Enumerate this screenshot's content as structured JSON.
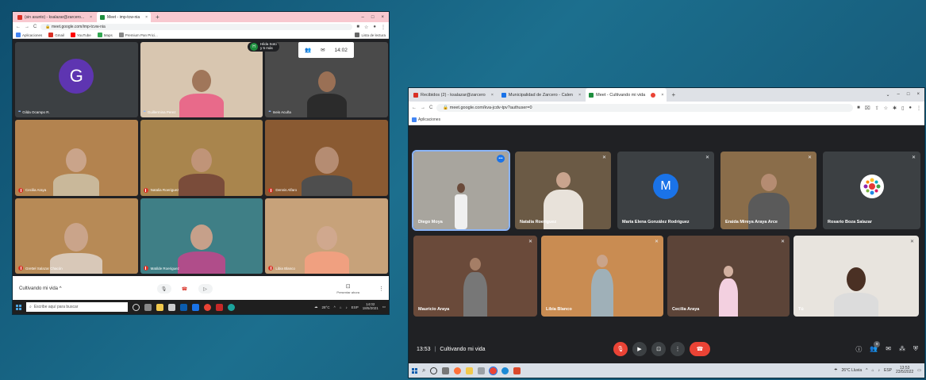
{
  "ss1": {
    "tabs": [
      {
        "label": "(sin asunto) - ksalazar@zarcero...",
        "active": false,
        "favicon_color": "#d93025"
      },
      {
        "label": "Meet - imp-tcw-nia",
        "active": true,
        "favicon_color": "#1e8e3e"
      }
    ],
    "url": "meet.google.com/imp-tcvw-nia",
    "bookmarks": [
      {
        "label": "Aplicaciones",
        "color": "#4285f4"
      },
      {
        "label": "Gmail",
        "color": "#d93025"
      },
      {
        "label": "YouTube",
        "color": "#ff0000"
      },
      {
        "label": "Maps",
        "color": "#34a853"
      },
      {
        "label": "Premium Pan Prici...",
        "color": "#888888"
      }
    ],
    "reading_list": "Lista de lectura",
    "badge": {
      "letter": "H",
      "line1": "Hilda Soto",
      "line2": "y 5 más"
    },
    "clock_top": "14:02",
    "tiles": [
      {
        "name": "Gilda Ocampo R.",
        "status": "speaking",
        "avatar_letter": "G",
        "avatar_color": "#5e35b1"
      },
      {
        "name": "Guillermina Perez",
        "status": "speaking",
        "bg": "#d8c6b0",
        "shirt": "#e86a8a"
      },
      {
        "name": "Ineis Acuña",
        "status": "speaking",
        "bg": "#4a4a4a",
        "shirt": "#2b2b2b"
      },
      {
        "name": "Cecilia Araya",
        "status": "muted",
        "bg": "#b3834f",
        "shirt": "#c9b89a"
      },
      {
        "name": "Natalia Roeriguez",
        "status": "muted",
        "bg": "#a9854d",
        "shirt": "#7a4c3a"
      },
      {
        "name": "Dennis Alfaro",
        "status": "muted",
        "bg": "#8a5a32",
        "shirt": "#4e4e4e"
      },
      {
        "name": "Grettel Salazar Chacón",
        "status": "muted",
        "bg": "#b78a56",
        "shirt": "#d8c8b8"
      },
      {
        "name": "Matilde Roeriguez",
        "status": "muted",
        "bg": "#3f7f86",
        "shirt": "#b04d8a"
      },
      {
        "name": "Libia Blanco",
        "status": "muted",
        "bg": "#c7a27a",
        "shirt": "#f0a080"
      }
    ],
    "meeting_title": "Cultivando mi vida",
    "present_label": "Presentar ahora",
    "taskbar": {
      "search_placeholder": "Escribe aquí para buscar",
      "weather": "28°C",
      "lang": "ESP",
      "time": "14:02",
      "date": "18/5/2021"
    }
  },
  "ss2": {
    "tabs": [
      {
        "label": "Recibidos (2) - ksalazar@zarcero",
        "active": false,
        "favicon_color": "#d93025"
      },
      {
        "label": "Municipalidad de Zarcero - Calen",
        "active": false,
        "favicon_color": "#1a73e8"
      },
      {
        "label": "Meet - Cultivando mi vida",
        "active": true,
        "favicon_color": "#1e8e3e"
      }
    ],
    "url": "meet.google.com/kva-jcdv-tpv?authuser=0",
    "bookmarks": [
      {
        "label": "Aplicaciones",
        "color": "#4285f4"
      }
    ],
    "tiles": [
      {
        "name": "Diego Moya",
        "speaking": true,
        "bg": "#a8a59e",
        "shirt": "#f0f0f0"
      },
      {
        "name": "Natalia Roeriguez",
        "speaking": false,
        "bg": "#6b5a45",
        "shirt": "#e8e2da"
      },
      {
        "name": "María Elena González Rodríguez",
        "speaking": false,
        "avatar_letter": "M",
        "avatar_color": "#1a73e8"
      },
      {
        "name": "Eraida Mireya Araya Arce",
        "speaking": false,
        "bg": "#8a6d4a",
        "shirt": "#5a5a5a"
      },
      {
        "name": "Rosario Boza Salazar",
        "speaking": false,
        "avatar_logo": true
      },
      {
        "name": "Mauricio Araya",
        "speaking": false,
        "bg": "#6a4a3a",
        "shirt": "#777777"
      },
      {
        "name": "Libia Blanco",
        "speaking": false,
        "bg": "#c98c52",
        "shirt": "#9fb0b8"
      },
      {
        "name": "Cecilia Araya",
        "speaking": false,
        "bg": "#5c4438",
        "shirt": "#f3d0e0"
      },
      {
        "name": "Tú",
        "speaking": false,
        "bg": "#e8e4de",
        "shirt": "#dcdcdc"
      }
    ],
    "meeting_time": "13:53",
    "meeting_title": "Cultivando mi vida",
    "people_count": "9",
    "taskbar": {
      "weather": "26°C Lluvia",
      "lang": "ESP",
      "time": "13:53",
      "date": "23/5/2022"
    }
  }
}
